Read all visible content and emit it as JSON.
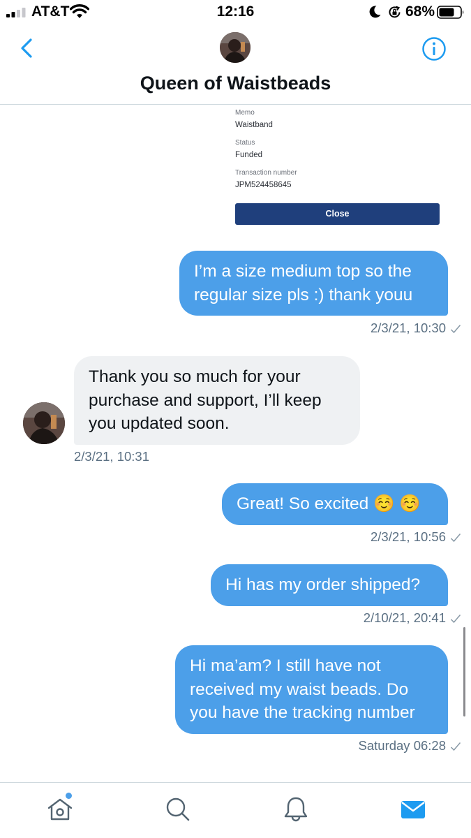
{
  "status_bar": {
    "carrier": "AT&T",
    "time": "12:16",
    "battery_percent": "68%",
    "icons": [
      "signal-icon",
      "wifi-icon",
      "moon-icon",
      "rotation-lock-icon",
      "battery-icon"
    ]
  },
  "header": {
    "title": "Queen of Waistbeads",
    "icons": {
      "back": "chevron-left-icon",
      "info": "info-icon"
    },
    "accent_color": "#1d9bf0"
  },
  "receipt": {
    "memo_label": "Memo",
    "memo_value": "Waistband",
    "status_label": "Status",
    "status_value": "Funded",
    "txn_label": "Transaction number",
    "txn_value": "JPM524458645",
    "close_label": "Close",
    "button_color": "#1f3f7c"
  },
  "messages": [
    {
      "direction": "sent",
      "text": "I’m a size medium top so the regular size pls :) thank youu",
      "time": "2/3/21, 10:30"
    },
    {
      "direction": "received",
      "text": "Thank you so much for your purchase and support, I’ll keep you updated soon.",
      "time": "2/3/21, 10:31"
    },
    {
      "direction": "sent",
      "text": "Great! So excited ☺️ ☺️",
      "time": "2/3/21, 10:56"
    },
    {
      "direction": "sent",
      "text": "Hi has my order shipped?",
      "time": "2/10/21, 20:41"
    },
    {
      "direction": "sent",
      "text": "Hi ma’am? I still have not received my waist beads. Do you have the tracking number",
      "time": "Saturday 06:28"
    }
  ],
  "colors": {
    "sent_bubble": "#4c9fe9",
    "received_bubble": "#eff1f3"
  },
  "tab_bar": {
    "tabs": [
      "home-icon",
      "search-icon",
      "notifications-icon",
      "messages-icon"
    ],
    "active": "messages-icon"
  }
}
